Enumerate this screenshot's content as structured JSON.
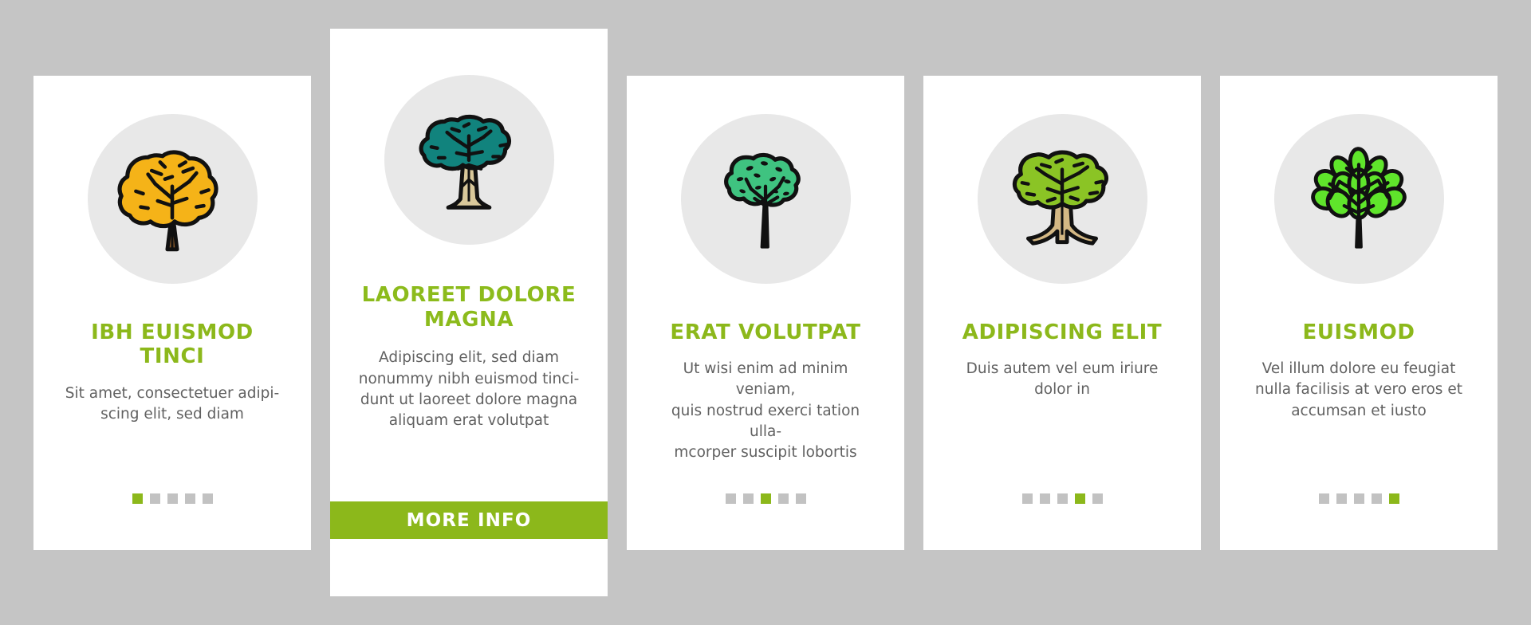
{
  "page": {
    "background_color": "#c5c5c5",
    "card_background": "#ffffff",
    "accent_green": "#8cb81b",
    "medallion_color": "#e8e8e8",
    "dot_inactive_color": "#c2c2c2",
    "body_text_color": "#616161"
  },
  "cards": [
    {
      "icon_name": "broadleaf-tree-icon",
      "icon": {
        "canopy_color": "#f5b318",
        "trunk_color": "#8a5a2b",
        "outline_color": "#111111"
      },
      "title": "IBH EUISMOD TINCI",
      "body": "Sit amet, consectetuer adipi-\nscing elit, sed diam",
      "featured": false,
      "dots": {
        "count": 5,
        "active_index": 1
      }
    },
    {
      "icon_name": "canopy-tree-icon",
      "icon": {
        "canopy_color": "#11837d",
        "trunk_color": "#d9c89a",
        "outline_color": "#111111"
      },
      "title": "LAOREET DOLORE MAGNA",
      "body": "Adipiscing elit, sed diam\nnonummy nibh euismod tinci-\ndunt ut laoreet dolore magna\naliquam erat volutpat",
      "featured": true,
      "button_label": "MORE INFO",
      "dots": null
    },
    {
      "icon_name": "slender-tree-icon",
      "icon": {
        "canopy_color": "#3fc380",
        "trunk_color": "#111111",
        "outline_color": "#111111"
      },
      "title": "ERAT VOLUTPAT",
      "body": "Ut wisi enim ad minim veniam,\nquis nostrud exerci tation ulla-\nmcorper suscipit lobortis",
      "featured": false,
      "dots": {
        "count": 5,
        "active_index": 3
      }
    },
    {
      "icon_name": "rooted-oak-tree-icon",
      "icon": {
        "canopy_color": "#8bc425",
        "trunk_color": "#d4b884",
        "outline_color": "#111111"
      },
      "title": "ADIPISCING ELIT",
      "body": "Duis autem vel eum iriure\ndolor in",
      "featured": false,
      "dots": {
        "count": 5,
        "active_index": 4
      }
    },
    {
      "icon_name": "leafy-shrub-icon",
      "icon": {
        "canopy_color": "#5fe52b",
        "trunk_color": "#111111",
        "outline_color": "#111111"
      },
      "title": "EUISMOD",
      "body": "Vel illum dolore eu feugiat\nnulla facilisis at vero eros et\naccumsan et iusto",
      "featured": false,
      "dots": {
        "count": 5,
        "active_index": 5
      }
    }
  ]
}
